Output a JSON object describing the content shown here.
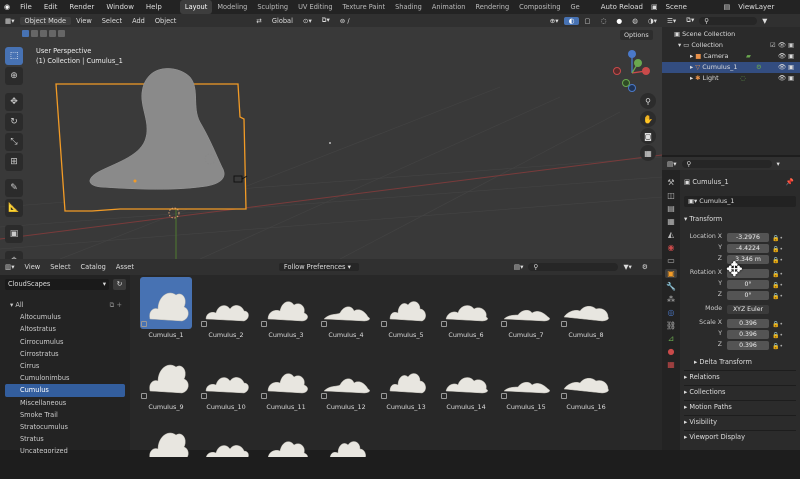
{
  "topbar": {
    "menus": [
      "File",
      "Edit",
      "Render",
      "Window",
      "Help"
    ],
    "tabs": [
      "Layout",
      "Modeling",
      "Sculpting",
      "UV Editing",
      "Texture Paint",
      "Shading",
      "Animation",
      "Rendering",
      "Compositing",
      "Ge"
    ],
    "active_tab": "Layout",
    "auto_reload": "Auto Reload",
    "scene": "Scene",
    "view_layer": "ViewLayer"
  },
  "viewport_header": {
    "mode": "Object Mode",
    "menus": [
      "View",
      "Select",
      "Add",
      "Object"
    ],
    "transform": "Global",
    "options": "Options"
  },
  "viewport": {
    "perspective": "User Perspective",
    "collection_info": "(1) Collection | Cumulus_1"
  },
  "asset_browser": {
    "menus": [
      "View",
      "Select",
      "Catalog",
      "Asset"
    ],
    "import_method": "Follow Preferences",
    "library": "CloudScapes",
    "catalog_root": "All",
    "catalogs": [
      "Altocumulus",
      "Altostratus",
      "Cirrocumulus",
      "Cirrostratus",
      "Cirrus",
      "Cumulonimbus",
      "Cumulus",
      "Miscellaneous",
      "Smoke Trail",
      "Stratocumulus",
      "Stratus",
      "Uncategorized"
    ],
    "selected_catalog": "Cumulus",
    "assets": [
      "Cumulus_1",
      "Cumulus_2",
      "Cumulus_3",
      "Cumulus_4",
      "Cumulus_5",
      "Cumulus_6",
      "Cumulus_7",
      "Cumulus_8",
      "Cumulus_9",
      "Cumulus_10",
      "Cumulus_11",
      "Cumulus_12",
      "Cumulus_13",
      "Cumulus_14",
      "Cumulus_15",
      "Cumulus_16"
    ],
    "selected_asset": "Cumulus_1"
  },
  "outliner": {
    "scene_collection": "Scene Collection",
    "collection": "Collection",
    "items": [
      "Camera",
      "Cumulus_1",
      "Light"
    ],
    "selected": "Cumulus_1"
  },
  "properties": {
    "object_name": "Cumulus_1",
    "data_name": "Cumulus_1",
    "transform_label": "Transform",
    "location_label": "Location X",
    "location": [
      "-3.2976",
      "-4.4224",
      "3.346 m"
    ],
    "rotation_label": "Rotation X",
    "rotation": [
      "",
      "0°",
      "0°"
    ],
    "mode_label": "Mode",
    "mode_value": "XYZ Euler",
    "scale_label": "Scale X",
    "scale": [
      "0.396",
      "0.396",
      "0.396"
    ],
    "axis_y": "Y",
    "axis_z": "Z",
    "sections": [
      "Delta Transform",
      "Relations",
      "Collections",
      "Motion Paths",
      "Visibility",
      "Viewport Display"
    ]
  },
  "colors": {
    "accent": "#4772b3",
    "selection_orange": "#f29b26",
    "background": "#1d1d1d"
  }
}
